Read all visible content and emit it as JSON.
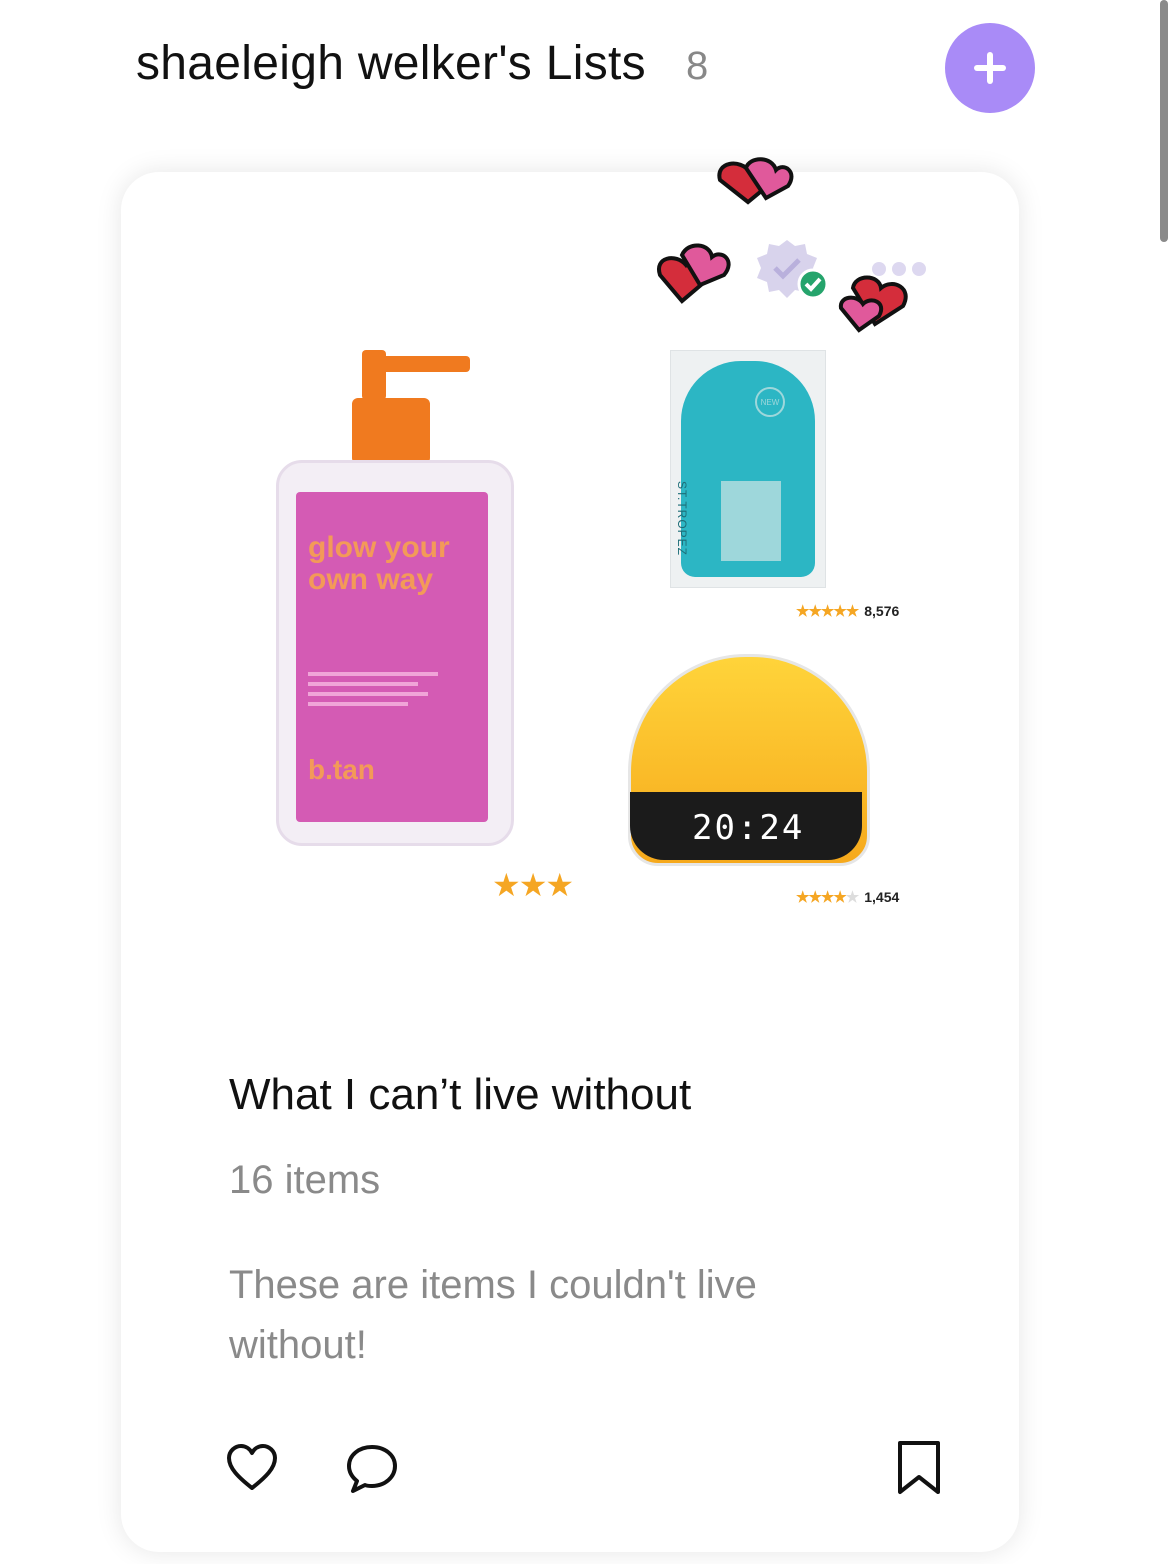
{
  "header": {
    "title": "shaeleigh welker's Lists",
    "count": "8",
    "add_icon": "plus-icon",
    "accent_color": "#a98bf7"
  },
  "card": {
    "products": [
      {
        "name": "b.tan self tan gel",
        "label_lines": [
          "glow your",
          "own way"
        ],
        "brand": "b.tan",
        "rating_stars": 2.5
      },
      {
        "name": "tan mitt",
        "brand": "ST.TROPEZ",
        "rating_stars": 4.5,
        "review_count": "8,576"
      },
      {
        "name": "sunrise alarm clock",
        "clock_time": "20:24",
        "rating_stars": 4,
        "review_count": "1,454"
      }
    ],
    "stickers": [
      "heart-sticker",
      "verified-badge-icon",
      "more-dots-icon"
    ],
    "title": "What I can’t live without",
    "item_count": "16 items",
    "description": "These are items I couldn't live without!",
    "actions": [
      "heart-icon",
      "comment-icon",
      "bookmark-icon"
    ]
  }
}
